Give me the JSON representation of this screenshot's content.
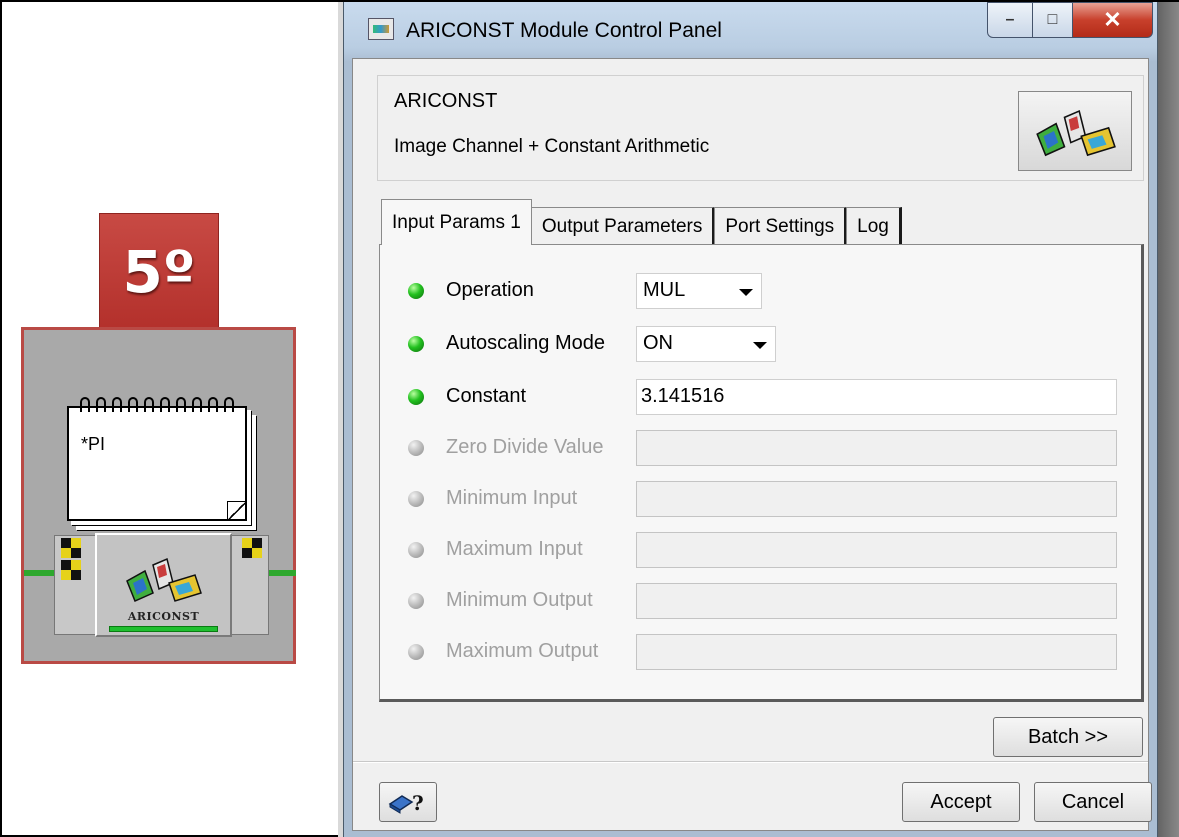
{
  "step_badge": {
    "label": "5º"
  },
  "module_node": {
    "note_label": "*PI",
    "module_label": "ARICONST"
  },
  "dialog": {
    "title": "ARICONST Module Control Panel",
    "window_buttons": {
      "minimize": "–",
      "maximize": "□",
      "close": "✕"
    },
    "header": {
      "module_name": "ARICONST",
      "description": "Image Channel + Constant Arithmetic"
    },
    "tabs": [
      {
        "label": "Input Params 1",
        "active": true
      },
      {
        "label": "Output Parameters",
        "active": false
      },
      {
        "label": "Port Settings",
        "active": false
      },
      {
        "label": "Log",
        "active": false
      }
    ],
    "params": [
      {
        "label": "Operation",
        "enabled": true,
        "type": "select",
        "value": "MUL"
      },
      {
        "label": "Autoscaling Mode",
        "enabled": true,
        "type": "select",
        "value": "ON"
      },
      {
        "label": "Constant",
        "enabled": true,
        "type": "text",
        "value": "3.141516"
      },
      {
        "label": "Zero Divide Value",
        "enabled": false,
        "type": "text",
        "value": ""
      },
      {
        "label": "Minimum Input",
        "enabled": false,
        "type": "text",
        "value": ""
      },
      {
        "label": "Maximum Input",
        "enabled": false,
        "type": "text",
        "value": ""
      },
      {
        "label": "Minimum Output",
        "enabled": false,
        "type": "text",
        "value": ""
      },
      {
        "label": "Maximum Output",
        "enabled": false,
        "type": "text",
        "value": ""
      }
    ],
    "batch_button": "Batch >>",
    "help_button": "?",
    "accept_button": "Accept",
    "cancel_button": "Cancel"
  }
}
